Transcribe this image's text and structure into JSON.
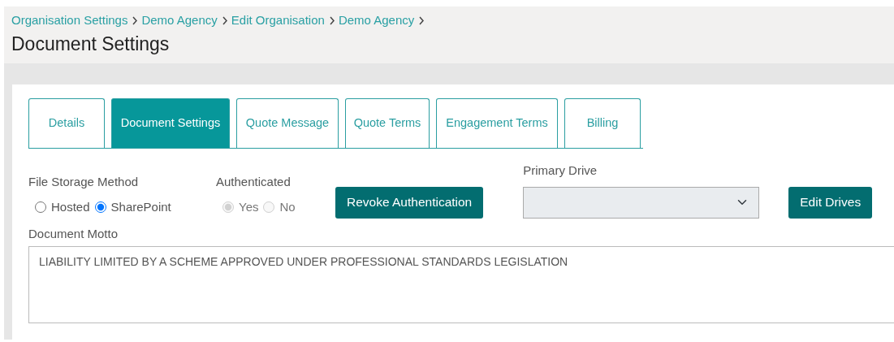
{
  "breadcrumbs": [
    "Organisation Settings",
    "Demo Agency",
    "Edit Organisation",
    "Demo Agency"
  ],
  "page_title": "Document Settings",
  "tabs": [
    {
      "label": "Details",
      "selected": false
    },
    {
      "label": "Document Settings",
      "selected": true
    },
    {
      "label": "Quote Message",
      "selected": false
    },
    {
      "label": "Quote Terms",
      "selected": false
    },
    {
      "label": "Engagement Terms",
      "selected": false
    },
    {
      "label": "Billing",
      "selected": false
    }
  ],
  "file_storage": {
    "label": "File Storage Method",
    "options": [
      {
        "label": "Hosted",
        "selected": false
      },
      {
        "label": "SharePoint",
        "selected": true
      }
    ]
  },
  "authenticated": {
    "label": "Authenticated",
    "disabled": true,
    "options": [
      {
        "label": "Yes",
        "selected": true
      },
      {
        "label": "No",
        "selected": false
      }
    ]
  },
  "revoke_button": "Revoke Authentication",
  "primary_drive": {
    "label": "Primary Drive",
    "disabled": true
  },
  "edit_drives_button": "Edit Drives",
  "document_motto": {
    "label": "Document Motto",
    "value": "LIABILITY LIMITED BY A SCHEME APPROVED UNDER PROFESSIONAL STANDARDS LEGISLATION"
  }
}
